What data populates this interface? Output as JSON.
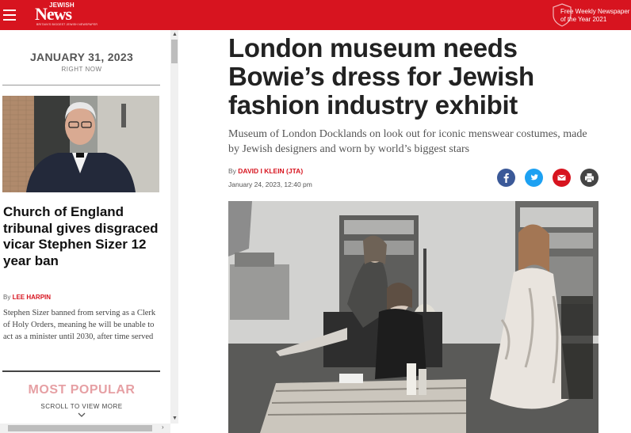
{
  "header": {
    "logo_small": "JEWISH",
    "logo_big": "News",
    "logo_tagline": "BRITAIN'S BIGGEST JEWISH NEWSPAPER",
    "award_line1": "Free Weekly Newspaper",
    "award_line2": "of the Year 2021"
  },
  "sidebar": {
    "date": "JANUARY 31, 2023",
    "now": "RIGHT NOW",
    "headline": "Church of England tribunal gives disgraced vicar Stephen Sizer 12 year ban",
    "by_prefix": "By",
    "author": "LEE HARPIN",
    "summary": "Stephen Sizer banned from serving as a Clerk of Holy Orders, meaning he will be unable to act as a minister until 2030, after time served",
    "most_popular": "MOST POPULAR",
    "scroll_hint": "SCROLL TO VIEW MORE"
  },
  "article": {
    "headline": "London museum needs Bowie’s dress for Jewish fashion industry exhibit",
    "subhead": "Museum of London Docklands on look out for iconic menswear costumes, made by Jewish designers and worn by world’s biggest stars",
    "by_prefix": "By",
    "author": "DAVID I KLEIN (JTA)",
    "date": "January 24, 2023, 12:40 pm"
  },
  "share": {
    "facebook_color": "#3b5998",
    "twitter_color": "#1da1f2",
    "email_color": "#d7141f",
    "print_color": "#444444"
  },
  "colors": {
    "brand_red": "#d7141f"
  }
}
